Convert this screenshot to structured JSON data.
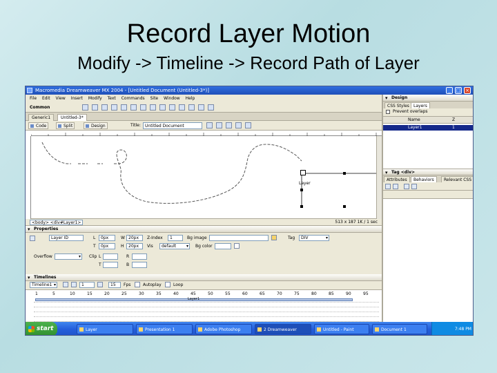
{
  "slide": {
    "title": "Record Layer Motion",
    "subtitle": "Modify -> Timeline -> Record Path of Layer"
  },
  "window": {
    "title": "Macromedia Dreamweaver MX 2004 - [Untitled Document (Untitled-3*)]",
    "buttons": [
      "_",
      "□",
      "×"
    ]
  },
  "menu": [
    "File",
    "Edit",
    "View",
    "Insert",
    "Modify",
    "Text",
    "Commands",
    "Site",
    "Window",
    "Help"
  ],
  "insert_bar": {
    "category": "Common"
  },
  "doc_tabs": [
    "Generic1",
    "Untitled-3*"
  ],
  "doc_toolbar": {
    "code": "Code",
    "split": "Split",
    "design": "Design",
    "title_label": "Title:",
    "title_value": "Untitled Document"
  },
  "design_view": {
    "layer_label": "Layer"
  },
  "status_bar": {
    "tag": "<body> <div#Layer1>",
    "right": "513 x 187 1K / 1 sec"
  },
  "properties": {
    "header": "Properties",
    "layer_id": "Layer ID",
    "l_label": "L",
    "l_value": "0px",
    "t_label": "T",
    "t_value": "0px",
    "w_label": "W",
    "w_value": "20px",
    "h_label": "H",
    "h_value": "20px",
    "z_label": "Z-Index",
    "z_value": "1",
    "bg_image_label": "Bg image",
    "vis_label": "Vis",
    "vis_value": "default",
    "tag_label": "Tag",
    "tag_value": "DIV",
    "bg_color_label": "Bg color",
    "overflow_label": "Overflow",
    "clip_label": "Clip",
    "clip_l": "L",
    "clip_r": "R",
    "clip_t": "T",
    "clip_b": "B"
  },
  "timelines": {
    "header": "Timelines",
    "name": "Timeline1",
    "frame": "1",
    "fps_value": "15",
    "fps_label": "Fps",
    "autoplay": "Autoplay",
    "loop": "Loop",
    "frames": [
      "1",
      "5",
      "10",
      "15",
      "20",
      "25",
      "30",
      "35",
      "40",
      "45",
      "50",
      "55",
      "60",
      "65",
      "70",
      "75",
      "80",
      "85",
      "90",
      "95"
    ],
    "bar_label": "Layer1"
  },
  "taskbar": {
    "start": "start",
    "items": [
      "Layer",
      "Presentation 1",
      "Adobe Photoshop",
      "2 Dreamweaver",
      "Untitled - Paint",
      "Document 1"
    ],
    "tray": "7:48 PM"
  },
  "right_panels": {
    "design_header": "Design",
    "design_tabs": [
      "CSS Styles",
      "Layers"
    ],
    "prevent_overlaps": "Prevent overlaps",
    "layers_columns": [
      "Name",
      "Z"
    ],
    "layers": [
      {
        "name": "Layer1",
        "z": "1"
      }
    ],
    "tag_header": "Tag <div>",
    "tag_tabs": [
      "Attributes",
      "Behaviors",
      "Relevant CSS"
    ]
  },
  "colors": {
    "titlebar": "#1f4fb8",
    "taskbar": "#245edb",
    "start": "#3a9c3a",
    "selection": "#14288a"
  }
}
